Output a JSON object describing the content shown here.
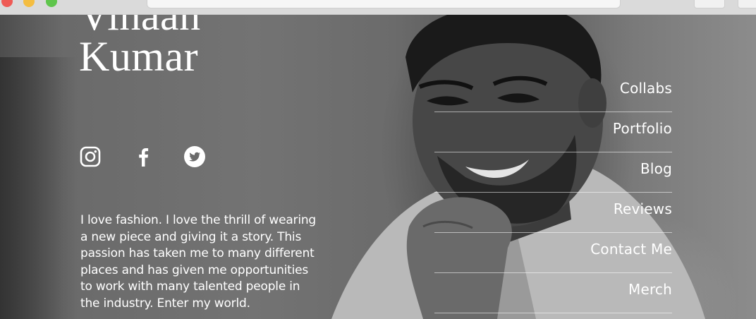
{
  "profile": {
    "name_line_1": "Vihaan",
    "name_line_2": "Kumar",
    "bio": "I love fashion. I love the thrill of wearing a new piece and giving it a story. This passion has taken me to many different places and has given me opportunities to work with many talented people in the industry. Enter my world."
  },
  "social": [
    {
      "icon": "instagram-icon"
    },
    {
      "icon": "facebook-icon"
    },
    {
      "icon": "twitter-icon"
    }
  ],
  "nav": {
    "items": [
      {
        "label": "Collabs"
      },
      {
        "label": "Portfolio"
      },
      {
        "label": "Blog"
      },
      {
        "label": "Reviews"
      },
      {
        "label": "Contact Me"
      },
      {
        "label": "Merch"
      }
    ]
  },
  "colors": {
    "text": "#ffffff",
    "divider": "#ffffffa0",
    "photo_tone": "#6e6e6e"
  }
}
